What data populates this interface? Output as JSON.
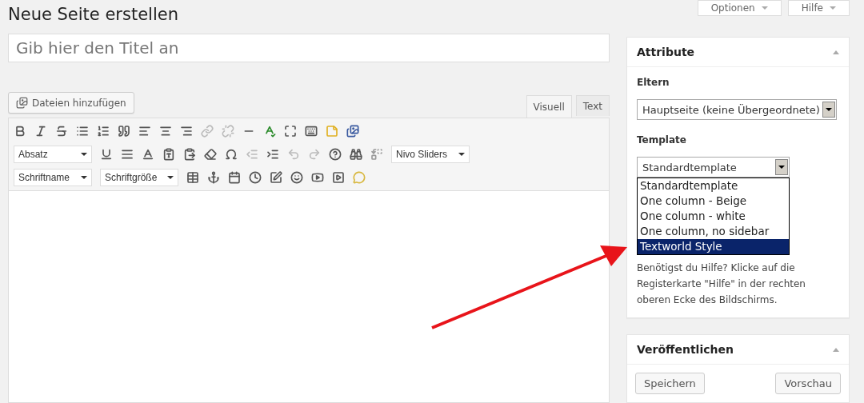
{
  "header": {
    "title": "Neue Seite erstellen",
    "buttons": [
      "Optionen",
      "Hilfe"
    ]
  },
  "title_field": {
    "placeholder": "Gib hier den Titel an"
  },
  "media_button": "Dateien hinzufügen",
  "editor_tabs": [
    {
      "label": "Visuell",
      "selected": true
    },
    {
      "label": "Text",
      "selected": false
    }
  ],
  "toolbar": {
    "format_select": "Absatz",
    "slider_select": "Nivo Sliders",
    "font_select": "Schriftname",
    "size_select": "Schriftgröße"
  },
  "attributes": {
    "title": "Attribute",
    "parent_label": "Eltern",
    "parent_value": "Hauptseite (keine Übergeordnete)",
    "template_label": "Template",
    "template_value": "Standardtemplate",
    "template_options": [
      {
        "label": "Standardtemplate",
        "selected": false
      },
      {
        "label": "One column - Beige",
        "selected": false
      },
      {
        "label": "One column - white",
        "selected": false
      },
      {
        "label": "One column, no sidebar",
        "selected": false
      },
      {
        "label": "Textworld Style",
        "selected": true
      }
    ],
    "help": "Benötigst du Hilfe? Klicke auf die Registerkarte \"Hilfe\" in der rechten oberen Ecke des Bildschirms."
  },
  "publish": {
    "title": "Veröffentlichen",
    "buttons": [
      "Speichern",
      "Vorschau"
    ]
  }
}
